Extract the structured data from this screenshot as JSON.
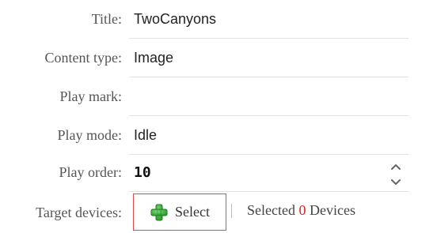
{
  "form": {
    "title": {
      "label": "Title:",
      "value": "TwoCanyons"
    },
    "content_type": {
      "label": "Content type:",
      "value": "Image"
    },
    "play_mark": {
      "label": "Play mark:",
      "value": ""
    },
    "play_mode": {
      "label": "Play mode:",
      "value": "Idle"
    },
    "play_order": {
      "label": "Play order:",
      "value": "10"
    },
    "target_devices": {
      "label": "Target devices:",
      "select_label": "Select",
      "selected_prefix": "Selected",
      "selected_count": "0",
      "selected_suffix": "Devices"
    }
  },
  "icons": {
    "select": "plus-circle-icon",
    "increment": "chevron-up-icon",
    "decrement": "chevron-down-icon"
  },
  "colors": {
    "select_border": "#e24a4a",
    "selected_count": "#e02020",
    "plus_icon": "#3aa83a"
  }
}
